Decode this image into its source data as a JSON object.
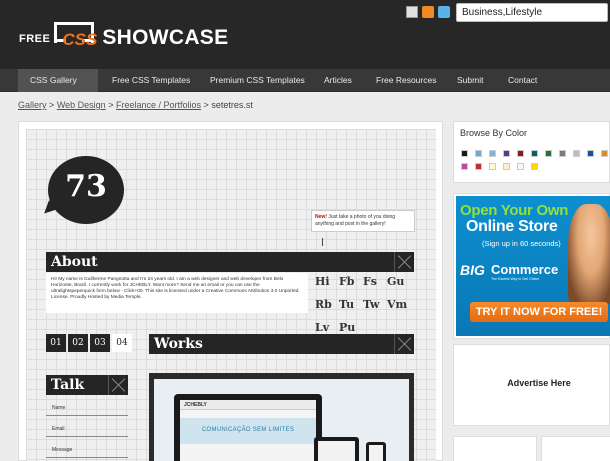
{
  "header": {
    "logo_free": "FREE",
    "logo_css": "CSS",
    "logo_showcase": "SHOWCASE",
    "icons": [
      "mail-icon",
      "rss-icon",
      "twitter-icon"
    ],
    "search_value": "Business,Lifestyle"
  },
  "nav": {
    "items": [
      "CSS Gallery",
      "Free CSS Templates",
      "Premium CSS Templates",
      "Articles",
      "Free Resources",
      "Submit",
      "Contact"
    ],
    "active": "CSS Gallery"
  },
  "breadcrumb": {
    "links": [
      "Gallery",
      "Web Design",
      "Freelance / Portfolios"
    ],
    "separator": ">",
    "current": "setetres.st"
  },
  "preview": {
    "number": "73",
    "note_new": "New!",
    "note_text": "Just take a photo of you doing anything and post in the gallery!",
    "about_title": "About",
    "about_text": "Hi! My name is Guilherme Pangnotta and I'm 24 years old. I am a web designer and web developer from Belo Horizonte, Brazil. I currently work for JCHEBLY. Want more? Send me an email or you can use the ultralightspeperquick form below - Click+00. This site is licensed under a Creative Commons Attribution 3.0 Unported License. Proudly Hosted by Media Temple.",
    "font_samples": [
      "Hi",
      "Fb",
      "Fs",
      "Gu",
      "Rb",
      "Tu",
      "Tw",
      "Vm",
      "Lv",
      "Pu"
    ],
    "tabs": [
      "01",
      "02",
      "03",
      "04"
    ],
    "active_tab": "04",
    "works_title": "Works",
    "talk_title": "Talk",
    "form_labels": [
      "Name",
      "Email",
      "Message"
    ],
    "screen_brand": "JCHEBLY",
    "screen_banner": "COMUNICAÇÃO SEM LIMITES"
  },
  "sidebar": {
    "browse_title": "Browse By Color",
    "colors": [
      "#1a1a1a",
      "#6aa9d8",
      "#7fb4e0",
      "#5b3a86",
      "#8b1a1a",
      "#0c5f5f",
      "#2a6f3a",
      "#7a7a7a",
      "#bdbdbd",
      "#1a4fa0",
      "#e08a20",
      "#b84ea0",
      "#c03030",
      "#fffbd0",
      "#ffeecc",
      "#f8f8f8",
      "#ffd700"
    ],
    "ad": {
      "line1": "Open Your Own",
      "line2": "Online Store",
      "line3": "(Sign up in 60 seconds)",
      "brand_big": "BIG",
      "brand_commerce": "Commerce",
      "brand_tagline": "The Easiest Way to Sell Online",
      "cta": "TRY IT NOW FOR FREE!"
    },
    "advertise_label": "Advertise Here"
  }
}
